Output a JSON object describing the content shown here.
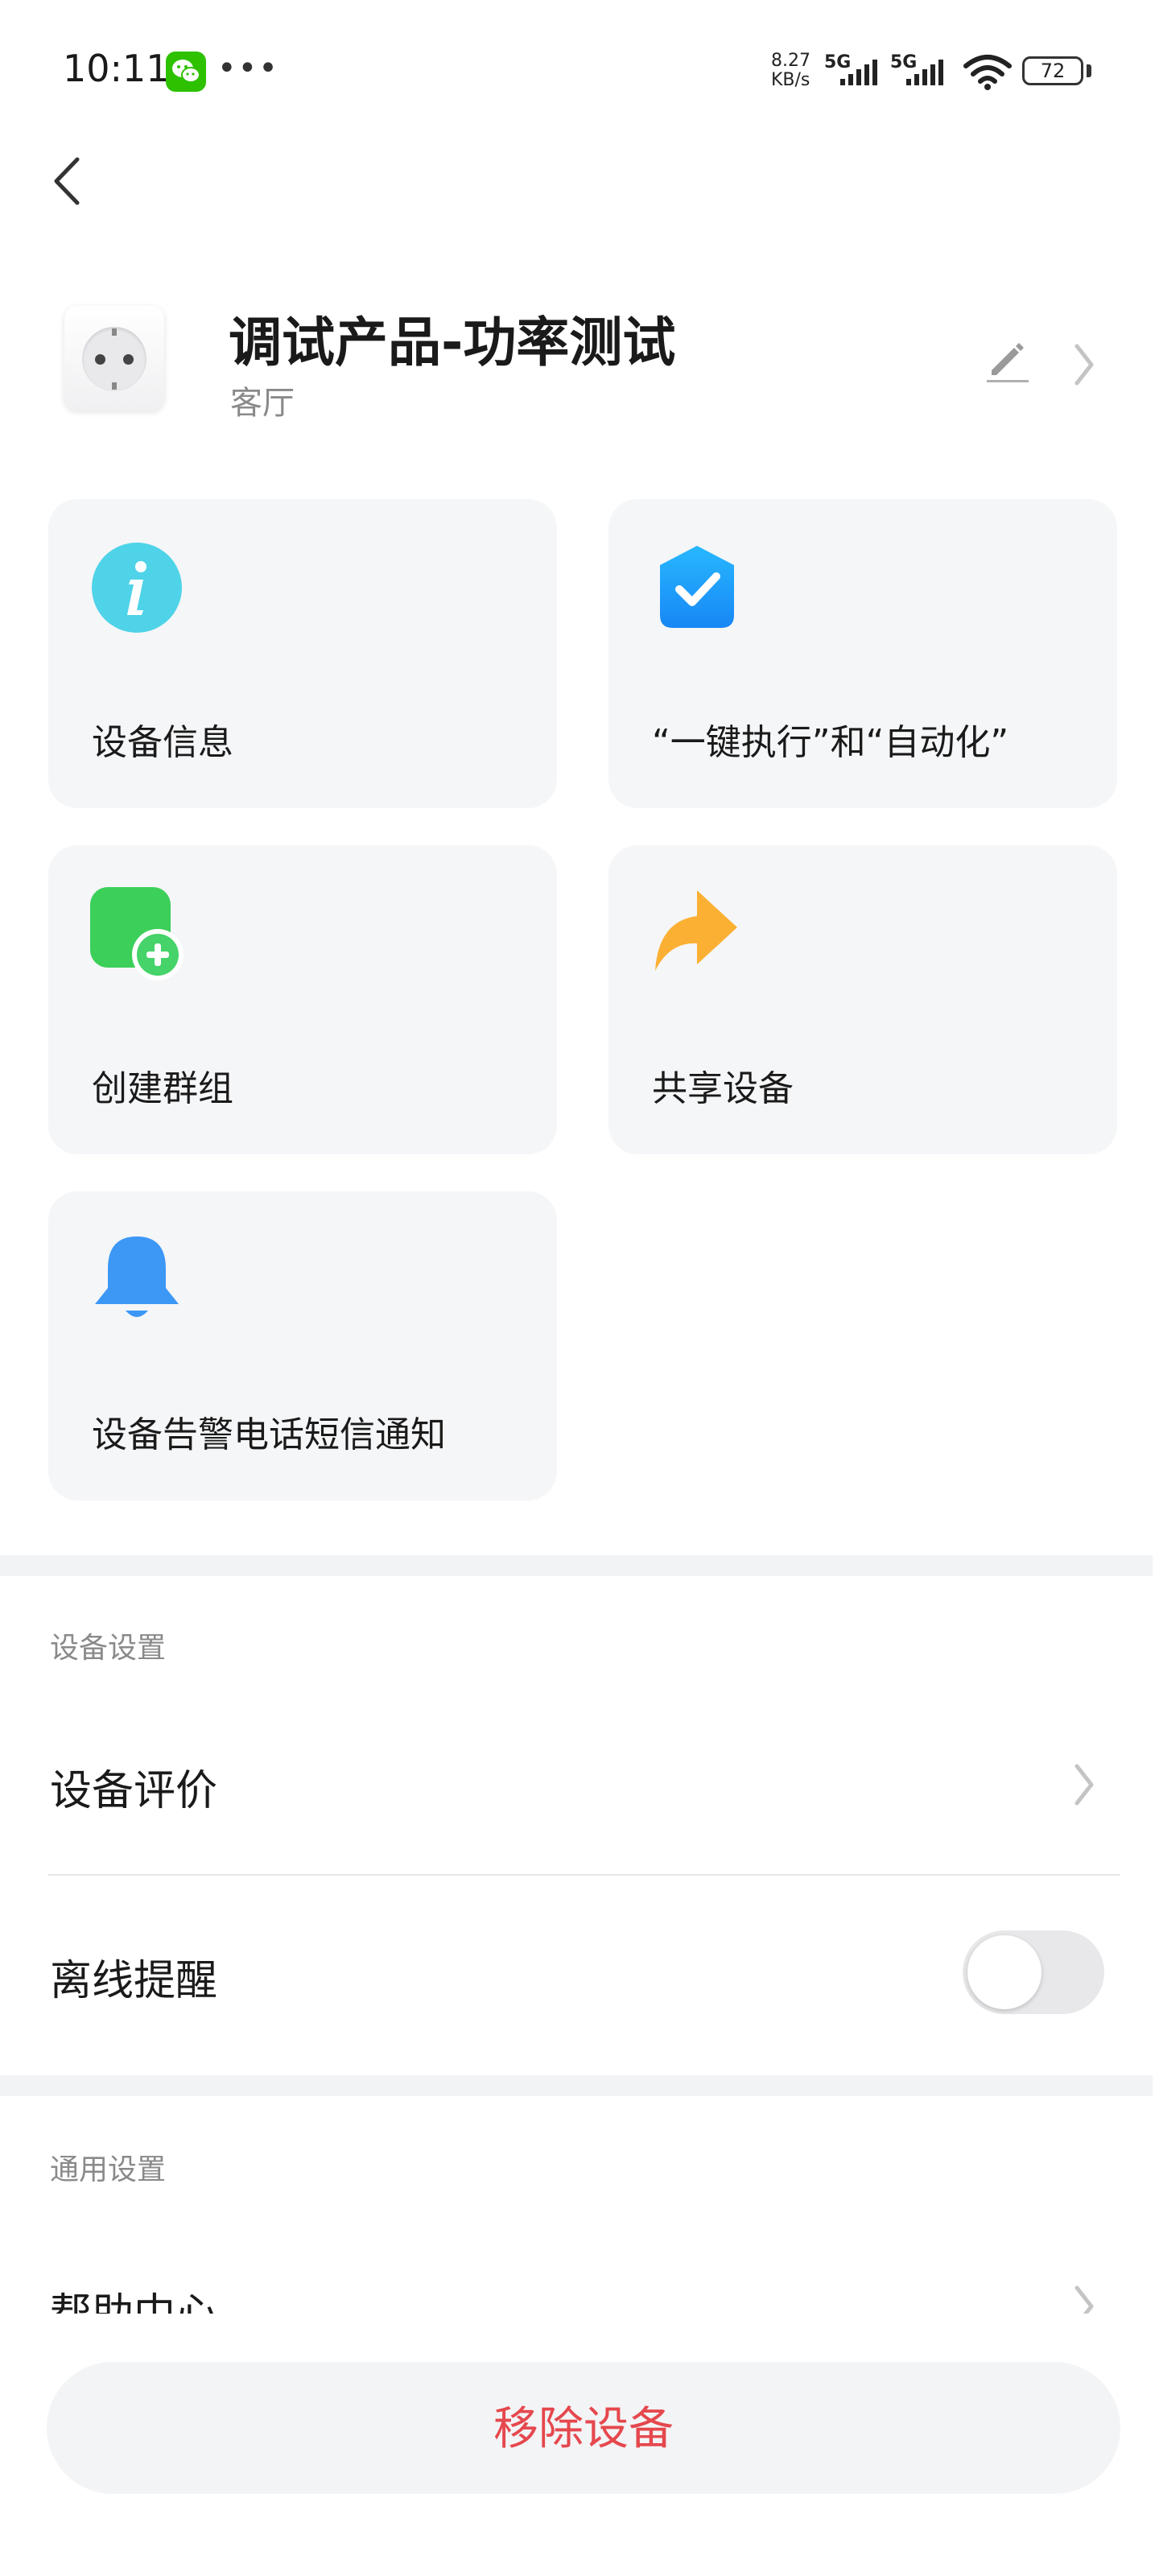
{
  "status_bar": {
    "time": "10:11",
    "net_speed_value": "8.27",
    "net_speed_unit": "KB/s",
    "signal_1_label": "5G",
    "signal_2_label": "5G",
    "battery": "72"
  },
  "device": {
    "name": "调试产品-功率测试",
    "room": "客厅"
  },
  "cards": [
    {
      "label": "设备信息",
      "icon": "info-icon",
      "color": "#4fd3e8"
    },
    {
      "label": "“一键执行”和“自动化”",
      "icon": "check-shield-icon",
      "color": "#1e9bff"
    },
    {
      "label": "创建群组",
      "icon": "create-group-icon",
      "color": "#3ccf5a"
    },
    {
      "label": "共享设备",
      "icon": "share-icon",
      "color": "#fbb034"
    },
    {
      "label": "设备告警电话短信通知",
      "icon": "bell-icon",
      "color": "#3d97f5"
    }
  ],
  "device_settings": {
    "title": "设备设置",
    "rating_label": "设备评价",
    "offline_alert_label": "离线提醒",
    "offline_alert_enabled": false
  },
  "general_settings": {
    "title": "通用设置",
    "help_center_label": "帮助中心"
  },
  "remove_button": "移除设备",
  "colors": {
    "danger": "#e5484d",
    "card_bg": "#f5f6f8",
    "muted_text": "#8a8a8a"
  }
}
